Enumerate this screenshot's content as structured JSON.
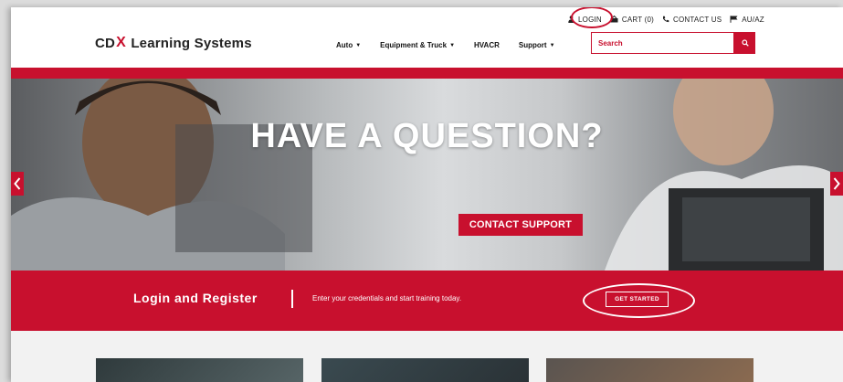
{
  "utility": {
    "login": "LOGIN",
    "cart": "CART (0)",
    "contact": "CONTACT US",
    "region": "AU/AZ"
  },
  "brand": {
    "logo_pre": "CD",
    "logo_x": "X",
    "logo_post": " Learning Systems"
  },
  "nav": {
    "items": [
      {
        "label": "Auto",
        "dropdown": true
      },
      {
        "label": "Equipment & Truck",
        "dropdown": true
      },
      {
        "label": "HVACR",
        "dropdown": false
      },
      {
        "label": "Support",
        "dropdown": true
      }
    ],
    "caret": "▼"
  },
  "search": {
    "placeholder": "Search"
  },
  "hero": {
    "title": "HAVE A QUESTION?",
    "cta": "CONTACT SUPPORT"
  },
  "banner": {
    "title": "Login and Register",
    "text": "Enter your credentials and start training today.",
    "button": "GET STARTED"
  },
  "colors": {
    "accent": "#c8102e",
    "text": "#222222",
    "white": "#ffffff"
  },
  "icons": [
    "user-icon",
    "cart-icon",
    "phone-icon",
    "flag-icon",
    "search-icon",
    "chevron-left-icon",
    "chevron-right-icon"
  ]
}
